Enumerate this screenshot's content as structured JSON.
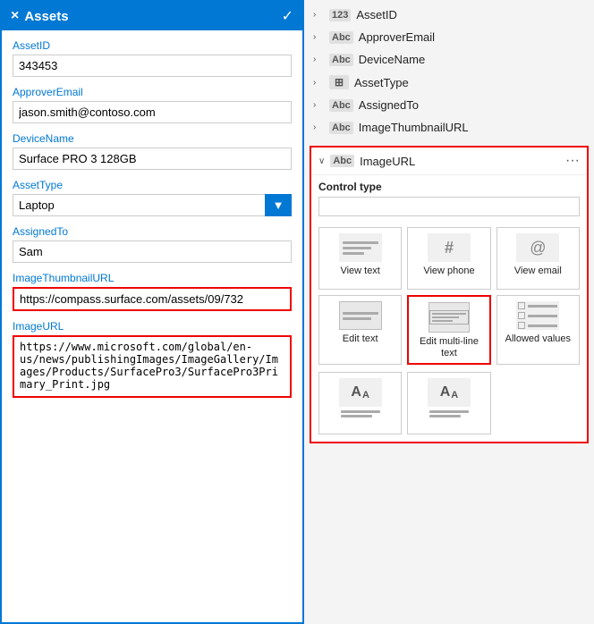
{
  "header": {
    "title": "Assets",
    "close_icon": "×",
    "check_icon": "✓"
  },
  "left_fields": [
    {
      "id": "assetid",
      "label": "AssetID",
      "value": "343453",
      "type": "input"
    },
    {
      "id": "approveremail",
      "label": "ApproverEmail",
      "value": "jason.smith@contoso.com",
      "type": "input"
    },
    {
      "id": "devicename",
      "label": "DeviceName",
      "value": "Surface PRO 3 128GB",
      "type": "input"
    },
    {
      "id": "assettype",
      "label": "AssetType",
      "value": "Laptop",
      "type": "select"
    },
    {
      "id": "assignedto",
      "label": "AssignedTo",
      "value": "Sam",
      "type": "input"
    },
    {
      "id": "imagethumbnailurl",
      "label": "ImageThumbnailURL",
      "value": "https://compass.surface.com/assets/09/732",
      "type": "input",
      "highlighted": true
    },
    {
      "id": "imageurl",
      "label": "ImageURL",
      "value": "https://www.microsoft.com/global/en-us/news/publishingImages/ImageGallery/Images/Products/SurfacePro3/SurfacePro3Primary_Print.jpg",
      "type": "textarea",
      "highlighted": true
    }
  ],
  "right_fields": [
    {
      "id": "assetid",
      "label": "AssetID",
      "type_icon": "123",
      "expanded": false
    },
    {
      "id": "approveremail",
      "label": "ApproverEmail",
      "type_icon": "Abc",
      "expanded": false
    },
    {
      "id": "devicename",
      "label": "DeviceName",
      "type_icon": "Abc",
      "expanded": false
    },
    {
      "id": "assettype",
      "label": "AssetType",
      "type_icon": "⊞",
      "expanded": false
    },
    {
      "id": "assignedto",
      "label": "AssignedTo",
      "type_icon": "Abc",
      "expanded": false
    },
    {
      "id": "imagethumbnailurl",
      "label": "ImageThumbnailURL",
      "type_icon": "Abc",
      "expanded": false
    }
  ],
  "imageurl_section": {
    "label": "ImageURL",
    "type_icon": "Abc",
    "control_type_label": "Control type",
    "control_type_value": ""
  },
  "control_tiles": [
    {
      "id": "view-text",
      "label": "View text",
      "selected": false
    },
    {
      "id": "view-phone",
      "label": "View phone",
      "selected": false
    },
    {
      "id": "view-email",
      "label": "View email",
      "selected": false
    },
    {
      "id": "edit-text",
      "label": "Edit text",
      "selected": false
    },
    {
      "id": "edit-multiline",
      "label": "Edit multi-line text",
      "selected": true
    },
    {
      "id": "allowed-values",
      "label": "Allowed values",
      "selected": false
    }
  ],
  "bottom_tiles": [
    {
      "id": "tile-aa-1",
      "label": "",
      "selected": false
    },
    {
      "id": "tile-aa-2",
      "label": "",
      "selected": false
    }
  ]
}
